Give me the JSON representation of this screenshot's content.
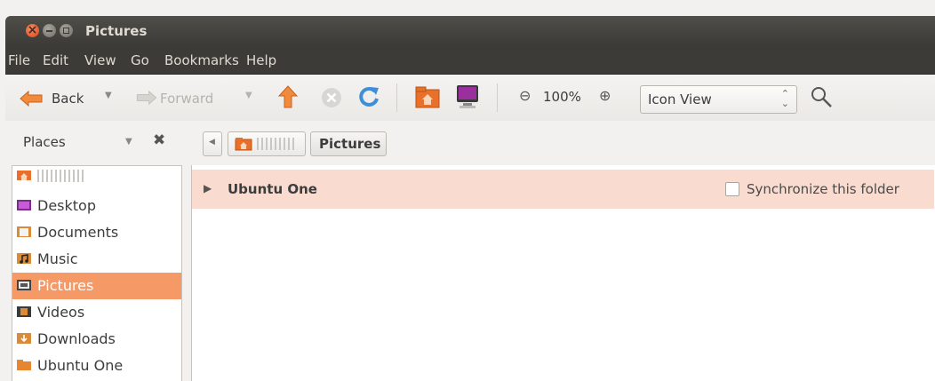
{
  "window": {
    "title": "Pictures"
  },
  "menubar": {
    "items": [
      "File",
      "Edit",
      "View",
      "Go",
      "Bookmarks",
      "Help"
    ]
  },
  "toolbar": {
    "back_label": "Back",
    "forward_label": "Forward",
    "zoom_level": "100%",
    "view_mode": "Icon View"
  },
  "sidebar": {
    "header": "Places",
    "items": [
      {
        "label": "",
        "icon": "home-folder-icon"
      },
      {
        "label": "Desktop",
        "icon": "desktop-folder-icon"
      },
      {
        "label": "Documents",
        "icon": "documents-folder-icon"
      },
      {
        "label": "Music",
        "icon": "music-folder-icon"
      },
      {
        "label": "Pictures",
        "icon": "pictures-folder-icon",
        "selected": true
      },
      {
        "label": "Videos",
        "icon": "videos-folder-icon"
      },
      {
        "label": "Downloads",
        "icon": "downloads-folder-icon"
      },
      {
        "label": "Ubuntu One",
        "icon": "ubuntu-one-folder-icon"
      }
    ]
  },
  "pathbar": {
    "current": "Pictures"
  },
  "ubuntu_one_bar": {
    "title": "Ubuntu One",
    "sync_label": "Synchronize this folder",
    "sync_checked": false
  },
  "colors": {
    "accent": "#f59a67",
    "titlebar": "#3c3b37",
    "info_bar": "#f9dccf"
  }
}
